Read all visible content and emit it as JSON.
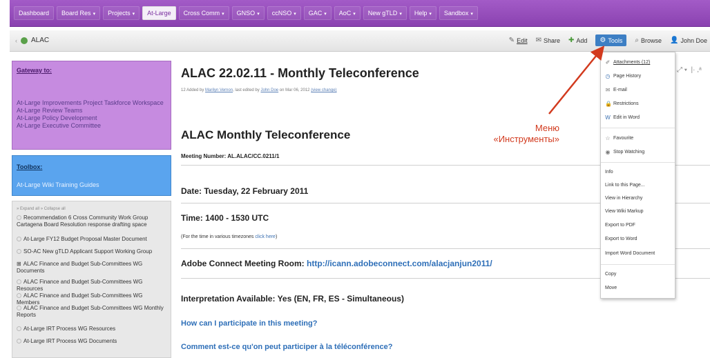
{
  "topnav": {
    "items": [
      {
        "label": "Dashboard",
        "dropdown": false
      },
      {
        "label": "Board Res",
        "dropdown": true
      },
      {
        "label": "Projects",
        "dropdown": true
      },
      {
        "label": "At-Large",
        "dropdown": false,
        "active": true
      },
      {
        "label": "Cross Comm",
        "dropdown": true
      },
      {
        "label": "GNSO",
        "dropdown": true
      },
      {
        "label": "ccNSO",
        "dropdown": true
      },
      {
        "label": "GAC",
        "dropdown": true
      },
      {
        "label": "AoC",
        "dropdown": true
      },
      {
        "label": "New gTLD",
        "dropdown": true
      },
      {
        "label": "Help",
        "dropdown": true
      },
      {
        "label": "Sandbox",
        "dropdown": true
      }
    ]
  },
  "toolbar": {
    "breadcrumb": "ALAC",
    "edit": "Edit",
    "share": "Share",
    "add": "Add",
    "tools": "Tools",
    "browse": "Browse",
    "user": "John Doe"
  },
  "sidebar": {
    "gateway_title": "Gateway to:",
    "gateway_links": [
      "At-Large Improvements Project Taskforce Workspace",
      "At-Large Review Teams",
      "At-Large Policy Development",
      "At-Large Executive Committee"
    ],
    "toolbox_title": "Toolbox:",
    "toolbox_link": "At-Large Wiki Training Guides",
    "tree_controls": "» Expand all  » Collapse all",
    "tree_items": [
      "Recommendation 6 Cross Community Work Group Cartagena Board Resolution response drafting space",
      "At-Large FY12 Budget Proposal Master Document",
      "SO-AC New gTLD Applicant Support Working Group",
      "ALAC Finance and Budget Sub-Committees WG Documents",
      "ALAC Finance and Budget Sub-Committees WG Resources",
      "ALAC Finance and Budget Sub-Committees WG Members",
      "ALAC Finance and Budget Sub-Committees WG Monthly Reports",
      "At-Large IRT Process WG Resources",
      "At-Large IRT Process WG Documents"
    ]
  },
  "page": {
    "title": "ALAC 22.02.11 - Monthly Teleconference",
    "meta_prefix": "12  Added by",
    "meta_author": "Marilyn Vernon",
    "meta_mid": ", last edited by",
    "meta_editor": "John Doe",
    "meta_date": " on Mar 06, 2012",
    "meta_changes": "(view change)",
    "heading": "ALAC Monthly Teleconference",
    "meeting_number": "Meeting Number: AL.ALAC/CC.0211/1",
    "date": "Date: Tuesday, 22 February 2011",
    "time": "Time: 1400 - 1530 UTC",
    "timezones_prefix": "(For the time in various timezones ",
    "timezones_link": "click here",
    "timezones_suffix": ")",
    "adobe_label": "Adobe Connect Meeting Room: ",
    "adobe_url": "http://icann.adobeconnect.com/alacjanjun2011/",
    "interpretation": "Interpretation Available: Yes (EN, FR, ES - Simultaneous)",
    "q_en": "How can I participate in this meeting?",
    "q_fr": "Comment est-ce qu'on peut participer à la téléconférence?"
  },
  "tools_menu": {
    "group1": [
      {
        "label": "Attachments (12)",
        "icon": "paperclip-icon"
      },
      {
        "label": "Page History",
        "icon": "history-icon"
      },
      {
        "label": "E-mail",
        "icon": "email-icon"
      },
      {
        "label": "Restrictions",
        "icon": "lock-icon"
      },
      {
        "label": "Edit in Word",
        "icon": "word-icon"
      }
    ],
    "group2": [
      {
        "label": "Favourite",
        "icon": "star-icon"
      },
      {
        "label": "Stop Watching",
        "icon": "eye-icon"
      }
    ],
    "group3": [
      "Info",
      "Link to this Page...",
      "View in Hierarchy",
      "View Wiki Markup",
      "Export to PDF",
      "Export to Word",
      "Import Word Document"
    ],
    "group4": [
      "Copy",
      "Move"
    ]
  },
  "annotation": {
    "line1": "Меню",
    "line2": "«Инструменты»",
    "color": "#d23a1e"
  }
}
